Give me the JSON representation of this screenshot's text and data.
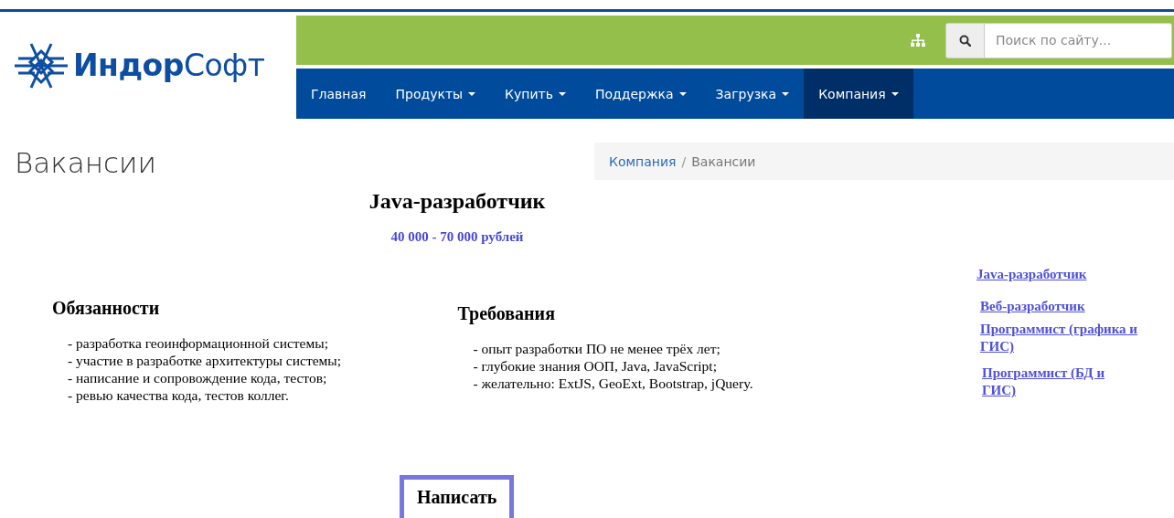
{
  "logo": {
    "text": "**Индор**Софт"
  },
  "search": {
    "placeholder": "Поиск по сайту..."
  },
  "nav": [
    {
      "label": "Главная",
      "has_menu": false,
      "selected": false
    },
    {
      "label": "Продукты",
      "has_menu": true,
      "selected": false
    },
    {
      "label": "Купить",
      "has_menu": true,
      "selected": false
    },
    {
      "label": "Поддержка",
      "has_menu": true,
      "selected": false
    },
    {
      "label": "Загрузка",
      "has_menu": true,
      "selected": false
    },
    {
      "label": "Компания",
      "has_menu": true,
      "selected": true
    }
  ],
  "page_title": "Вакансии",
  "breadcrumb_separator": "/",
  "breadcrumb": [
    {
      "label": "Компания",
      "kind": "link"
    },
    {
      "label": "Вакансии",
      "kind": "current"
    }
  ],
  "vacancy": {
    "title": "Java-разработчик",
    "salary": "40 000 - 70 000 рублей",
    "duties": {
      "heading": "Обязанности",
      "items": [
        "- разработка геоинформационной системы;",
        "- участие в разработке архитектуры системы;",
        "- написание и сопровождение кода, тестов;",
        "- ревью качества кода, тестов коллег."
      ]
    },
    "requirements": {
      "heading": "Требования",
      "items": [
        "- опыт разработки ПО не менее трёх лет;",
        "- глубокие знания ООП, Java, JavaScript;",
        "- желательно: ExtJS, GeoExt, Bootstrap, jQuery."
      ]
    },
    "button": "Написать"
  },
  "sidebar": [
    "Java-разработчик",
    "Веб-разработчик",
    "Программист (графика и ГИС)",
    "Программист (БД и ГИС)"
  ]
}
